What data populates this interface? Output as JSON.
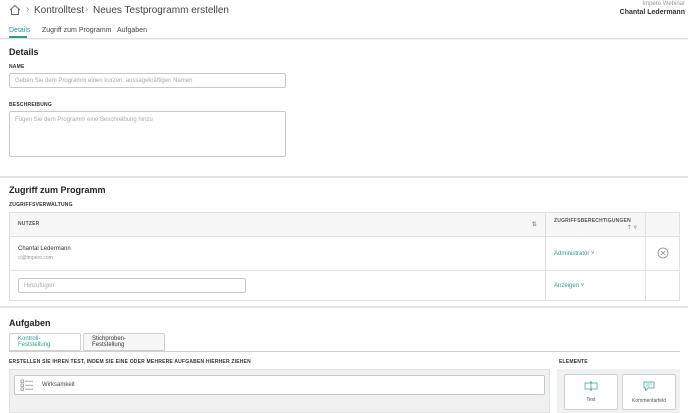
{
  "breadcrumb": {
    "items": [
      "Kontrolltest",
      "Neues Testprogramm erstellen"
    ]
  },
  "user": {
    "org": "Impero Webinar",
    "name": "Chantal Ledermann"
  },
  "tabs": [
    {
      "label": "Details",
      "active": true
    },
    {
      "label": "Zugriff zum Programm",
      "active": false
    },
    {
      "label": "Aufgaben",
      "active": false
    }
  ],
  "details": {
    "title": "Details",
    "name_label": "NAME",
    "name_placeholder": "Geben Sie dem Programm einen kurzen, aussagekräftigen Namen",
    "desc_label": "BESCHREIBUNG",
    "desc_placeholder": "Fügen Sie dem Programm eine Beschreibung hinzu"
  },
  "access": {
    "title": "Zugriff zum Programm",
    "subtitle": "ZUGRIFFSVERWALTUNG",
    "col_user": "NUTZER",
    "col_perm": "ZUGRIFFSBERECHTIGUNGEN",
    "rows": [
      {
        "name": "Chantal Ledermann",
        "email": "cl@impero.com",
        "permission": "Administrator"
      }
    ],
    "add_placeholder": "Hinzufügen",
    "add_permission": "Anzeigen"
  },
  "tasks": {
    "title": "Aufgaben",
    "tab_control": "Kontroll-Feststellung",
    "tab_sample": "Stichproben-Feststellung",
    "instruction": "ERSTELLEN SIE IHREN TEST, INDEM SIE EINE ODER MEHRERE AUFGABEN HIERHER ZIEHEN",
    "item": "Wirksamkeit",
    "elements_label": "ELEMENTE",
    "element_text": "Text",
    "element_comment": "Kommentarfeld"
  },
  "colors": {
    "accent": "#2a9d8f"
  }
}
